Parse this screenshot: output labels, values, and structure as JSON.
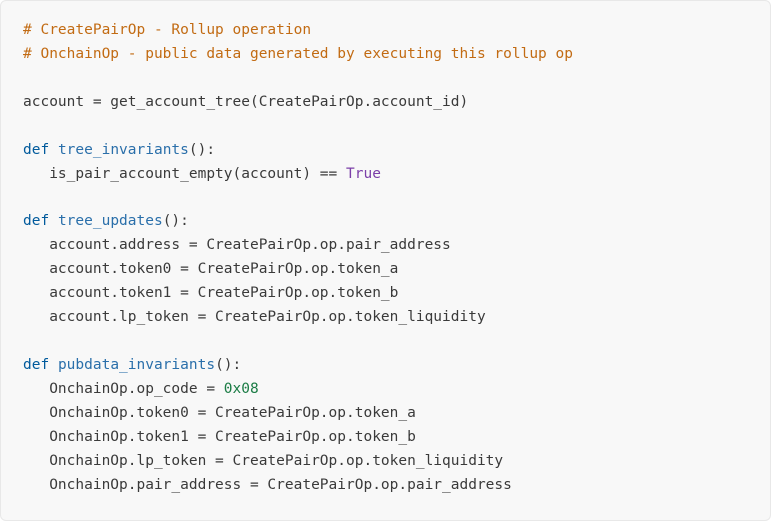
{
  "comments": {
    "c1": "# CreatePairOp - Rollup operation",
    "c2": "# OnchainOp - public data generated by executing this rollup op"
  },
  "code": {
    "assign1": "account = get_account_tree(CreatePairOp.account_id)",
    "def_kw": "def",
    "fn1_name": "tree_invariants",
    "fn1_parens": "():",
    "fn1_body_l1_pre": "   is_pair_account_empty(account) == ",
    "true_const": "True",
    "fn2_name": "tree_updates",
    "fn2_parens": "():",
    "fn2_body_l1": "   account.address = CreatePairOp.op.pair_address",
    "fn2_body_l2": "   account.token0 = CreatePairOp.op.token_a",
    "fn2_body_l3": "   account.token1 = CreatePairOp.op.token_b",
    "fn2_body_l4": "   account.lp_token = CreatePairOp.op.token_liquidity",
    "fn3_name": "pubdata_invariants",
    "fn3_parens": "():",
    "fn3_body_l1_pre": "   OnchainOp.op_code = ",
    "hex_val": "0x08",
    "fn3_body_l2": "   OnchainOp.token0 = CreatePairOp.op.token_a",
    "fn3_body_l3": "   OnchainOp.token1 = CreatePairOp.op.token_b",
    "fn3_body_l4": "   OnchainOp.lp_token = CreatePairOp.op.token_liquidity",
    "fn3_body_l5": "   OnchainOp.pair_address = CreatePairOp.op.pair_address"
  }
}
